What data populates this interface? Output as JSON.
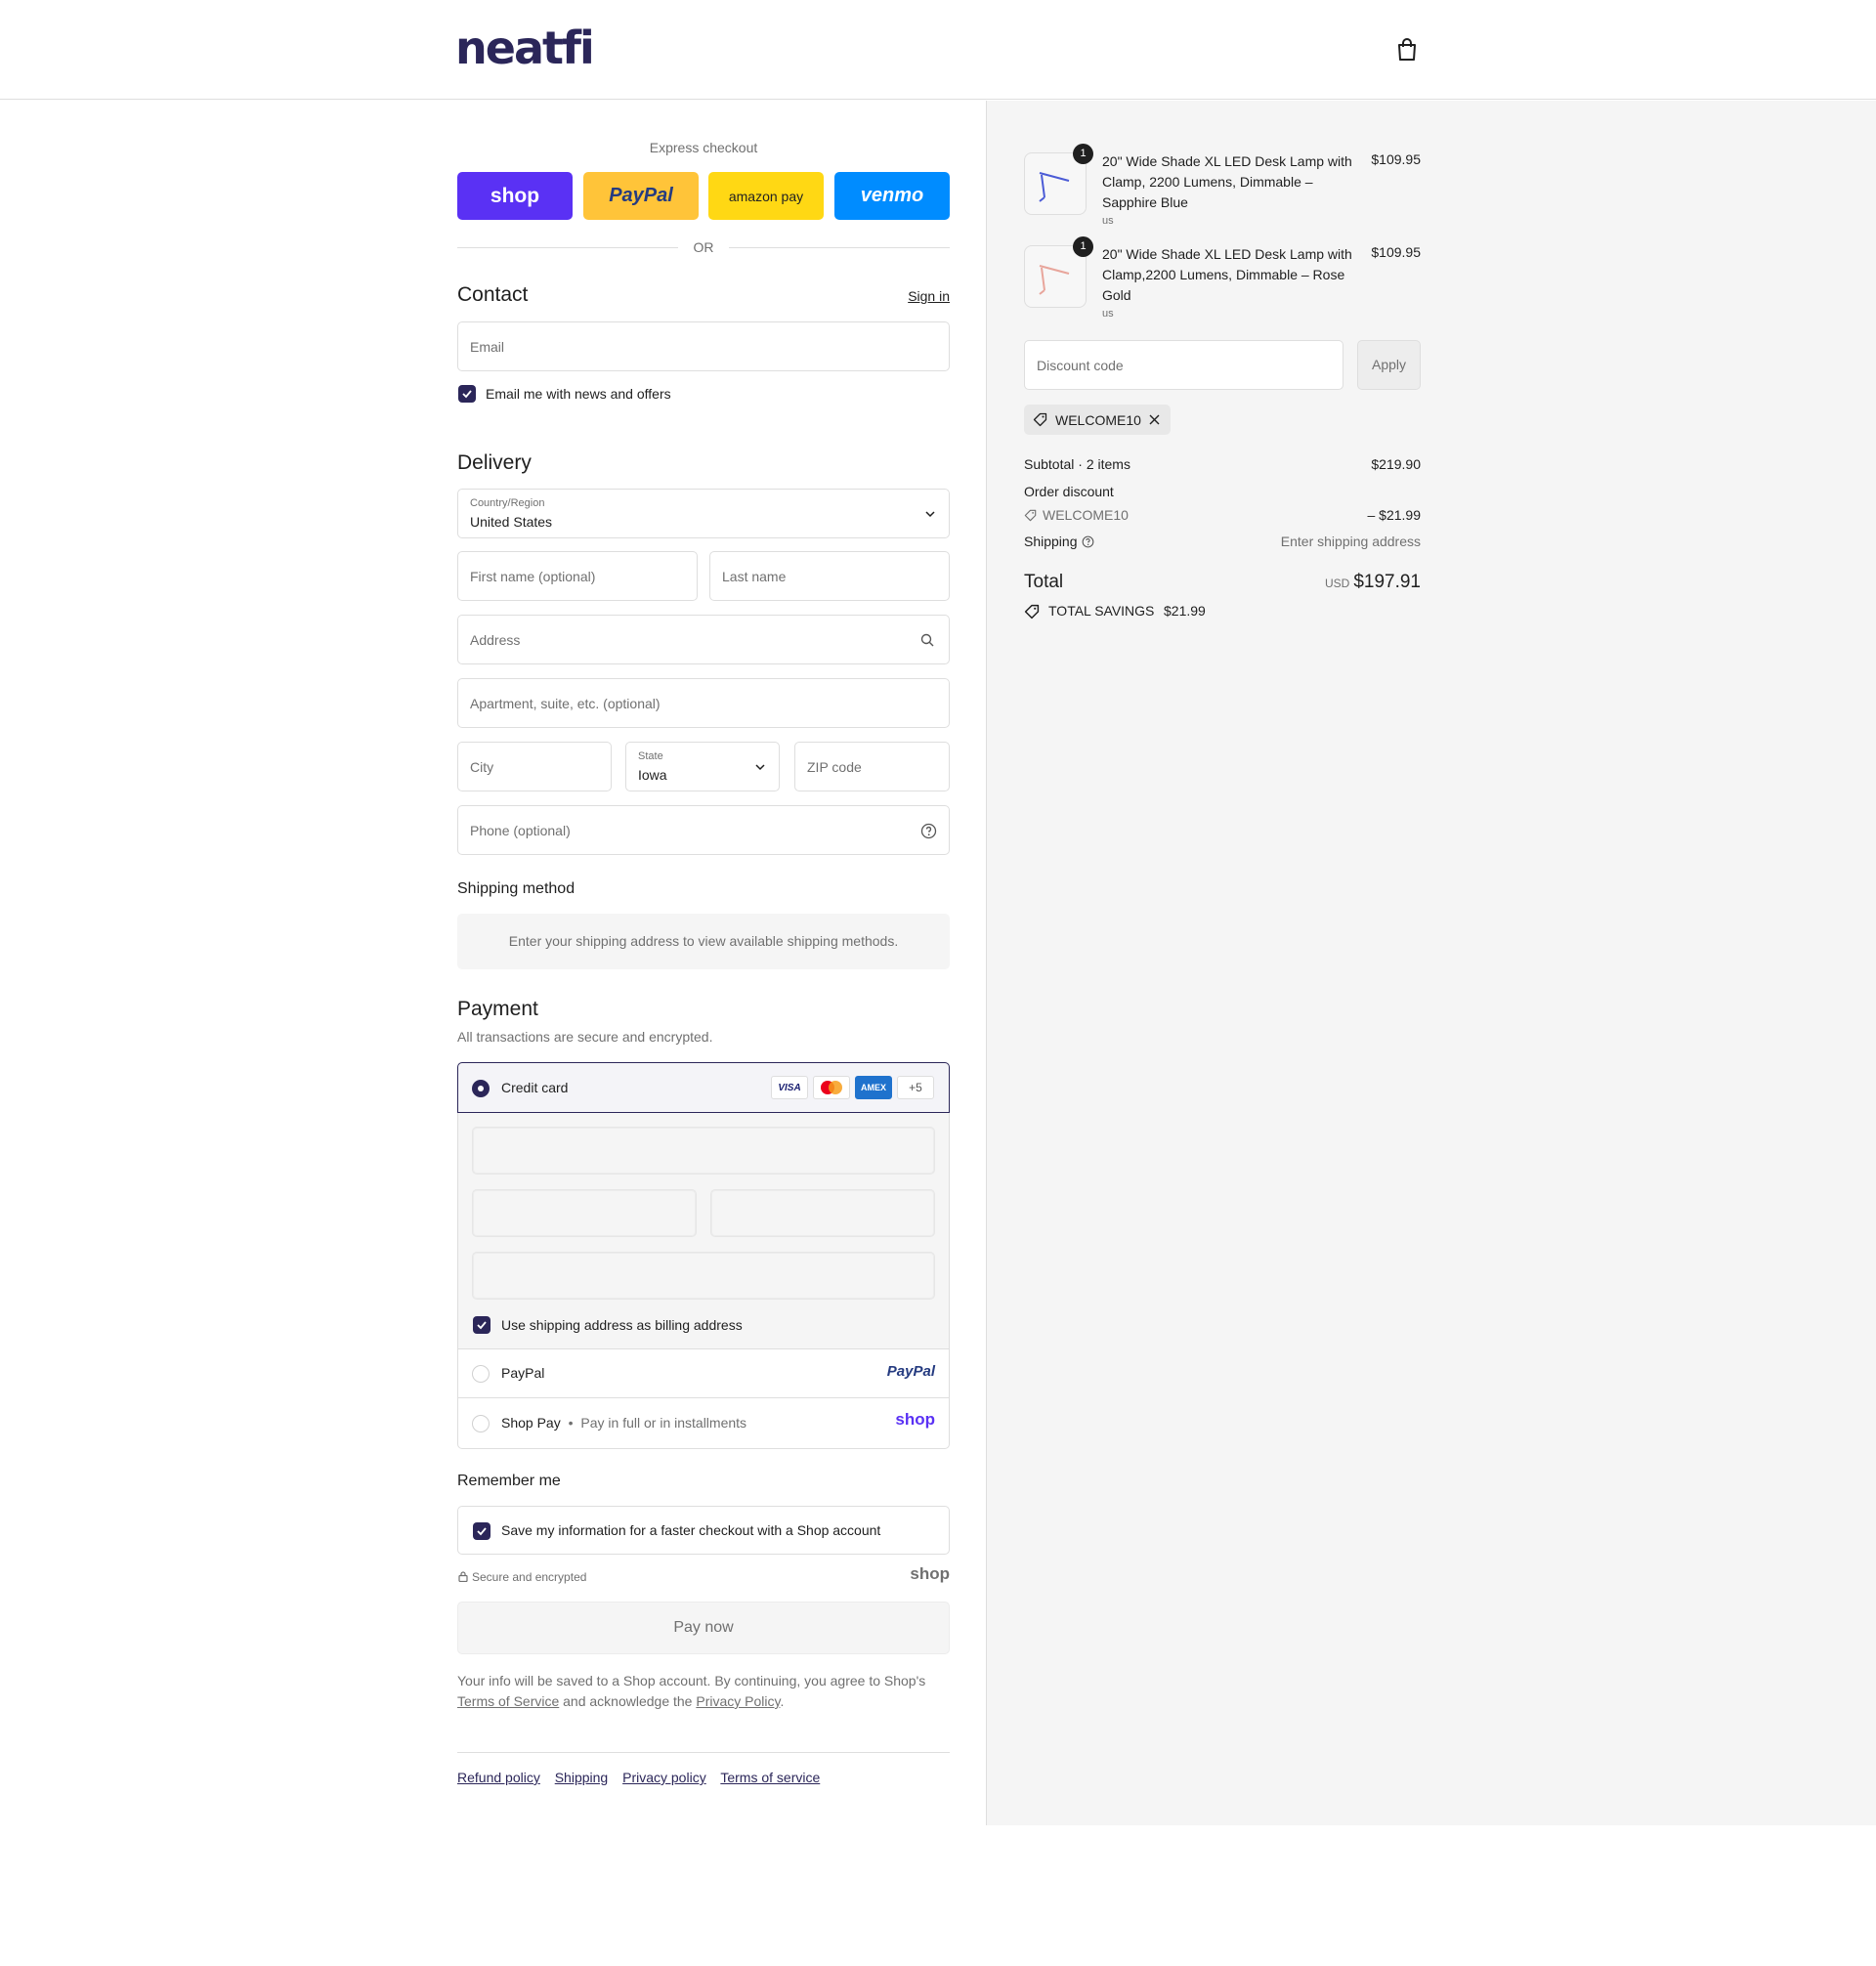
{
  "brand": {
    "logo_text": "neatfi",
    "accent": "#2b2659"
  },
  "header": {
    "cart_icon": "shopping-bag-icon"
  },
  "express": {
    "title": "Express checkout",
    "buttons": [
      {
        "label": "shop",
        "color": "#5a31f4"
      },
      {
        "label": "PayPal",
        "color": "#ffc439"
      },
      {
        "label": "amazon pay",
        "color": "#ffd814"
      },
      {
        "label": "venmo",
        "color": "#008cff"
      }
    ],
    "or_label": "OR"
  },
  "contact": {
    "title": "Contact",
    "sign_in": "Sign in",
    "email_placeholder": "Email",
    "news_label": "Email me with news and offers"
  },
  "delivery": {
    "title": "Delivery",
    "country_label": "Country/Region",
    "country_value": "United States",
    "first_name_placeholder": "First name (optional)",
    "last_name_placeholder": "Last name",
    "address_placeholder": "Address",
    "apartment_placeholder": "Apartment, suite, etc. (optional)",
    "city_placeholder": "City",
    "state_label": "State",
    "state_value": "Iowa",
    "zip_placeholder": "ZIP code",
    "phone_placeholder": "Phone (optional)"
  },
  "shipping_method": {
    "title": "Shipping method",
    "message": "Enter your shipping address to view available shipping methods."
  },
  "payment": {
    "title": "Payment",
    "subtitle": "All transactions are secure and encrypted.",
    "credit_card_label": "Credit card",
    "card_brands": [
      "VISA",
      "Mastercard",
      "AMEX",
      "+5"
    ],
    "billing_label": "Use shipping address as billing address",
    "paypal_label": "PayPal",
    "paypal_logo": "PayPal",
    "shoppay_label": "Shop Pay",
    "shoppay_sub": "Pay in full or in installments",
    "shoppay_logo": "shop"
  },
  "remember": {
    "title": "Remember me",
    "save_label": "Save my information for a faster checkout with a Shop account",
    "secure_label": "Secure and encrypted",
    "shop_logo": "shop"
  },
  "pay_now": "Pay now",
  "legal": {
    "line1": "Your info will be saved to a Shop account. By continuing, you agree to Shop's",
    "terms": "Terms of Service",
    "middle": "and acknowledge the",
    "privacy": "Privacy Policy",
    "end": "."
  },
  "footer_links": [
    "Refund policy",
    "Shipping",
    "Privacy policy",
    "Terms of service"
  ],
  "cart": {
    "items": [
      {
        "qty": "1",
        "name": "20\" Wide Shade XL LED Desk Lamp with Clamp, 2200 Lumens, Dimmable – Sapphire Blue",
        "variant": "us",
        "price": "$109.95",
        "lamp_color": "#4b5bd6"
      },
      {
        "qty": "1",
        "name": "20\" Wide Shade XL LED Desk Lamp with Clamp,2200 Lumens, Dimmable – Rose Gold",
        "variant": "us",
        "price": "$109.95",
        "lamp_color": "#e8a59b"
      }
    ],
    "discount_placeholder": "Discount code",
    "apply_label": "Apply",
    "applied_code": "WELCOME10",
    "subtotal_label": "Subtotal · 2 items",
    "subtotal_value": "$219.90",
    "order_discount_label": "Order discount",
    "discount_code": "WELCOME10",
    "discount_value": "– $21.99",
    "shipping_label": "Shipping",
    "shipping_value": "Enter shipping address",
    "total_label": "Total",
    "currency": "USD",
    "total_value": "$197.91",
    "savings_label": "TOTAL SAVINGS",
    "savings_value": "$21.99"
  }
}
